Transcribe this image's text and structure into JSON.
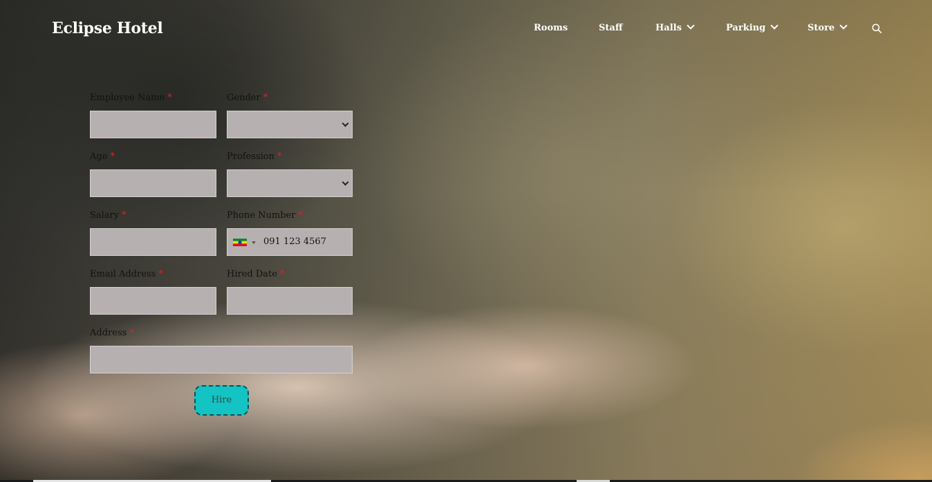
{
  "brand": {
    "title": "Eclipse Hotel"
  },
  "nav": {
    "items": [
      {
        "label": "Rooms",
        "has_dropdown": false
      },
      {
        "label": "Staff",
        "has_dropdown": false
      },
      {
        "label": "Halls",
        "has_dropdown": true
      },
      {
        "label": "Parking",
        "has_dropdown": true
      },
      {
        "label": "Store",
        "has_dropdown": true
      }
    ],
    "search_icon": "search-icon"
  },
  "form": {
    "required_marker": "*",
    "employee_name": {
      "label": "Employee Name",
      "value": "",
      "placeholder": ""
    },
    "gender": {
      "label": "Gender",
      "selected": ""
    },
    "age": {
      "label": "Age",
      "value": "",
      "placeholder": ""
    },
    "profession": {
      "label": "Profession",
      "selected": ""
    },
    "salary": {
      "label": "Salary",
      "value": "",
      "placeholder": ""
    },
    "phone_number": {
      "label": "Phone Number",
      "placeholder": "091 123 4567",
      "flag": "ethiopia-flag-icon"
    },
    "email_address": {
      "label": "Email Address",
      "value": "",
      "placeholder": ""
    },
    "hired_date": {
      "label": "Hired Date",
      "value": "",
      "placeholder": ""
    },
    "address": {
      "label": "Address",
      "value": "",
      "placeholder": ""
    },
    "submit_label": "Hire"
  },
  "colors": {
    "field_bg": "#b7b0b1",
    "button_bg": "#14c3c3",
    "required": "#e02020"
  }
}
